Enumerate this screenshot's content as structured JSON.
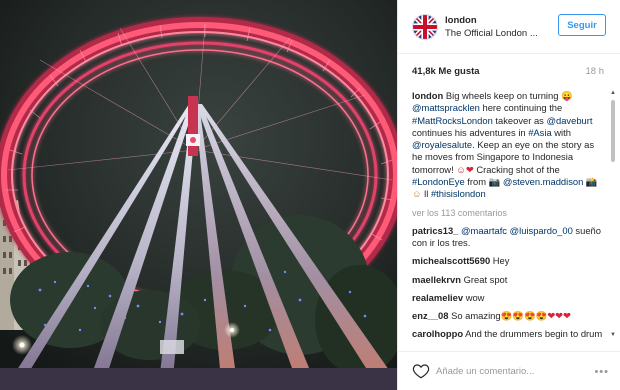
{
  "post": {
    "image_alt": "London Eye at night, lit red, viewed from below",
    "account": {
      "username": "london",
      "full_name": "The Official London ...",
      "avatar_icon": "union-jack-icon"
    },
    "follow_label": "Seguir",
    "likes": "41,8k Me gusta",
    "time_ago": "18 h",
    "caption": {
      "user": "london",
      "t1": " Big wheels keep on turning ",
      "m1": "@mattspracklen",
      "t2": " here continuing the ",
      "h1": "#MattRocksLondon",
      "t3": " takeover as ",
      "m2": "@daveburt",
      "t4": " continues his adventures in ",
      "h2": "#Asia",
      "t5": " with ",
      "m3": "@royalesalute",
      "t6": ". Keep an eye on the story as he moves from Singapore to Indonesia tomorrow! ",
      "e1": "☺❤",
      "t7": " Cracking shot of the ",
      "h3": "#LondonEye",
      "t8": " from ",
      "e2": "📷",
      "m4": "@steven.maddison",
      "e3": " 📸☺",
      "t9": " ll ",
      "h4": "#thisislondon"
    },
    "view_all": "ver los 113 comentarios",
    "comments": [
      {
        "user": "patrics13_",
        "parts": [
          {
            "text": " "
          },
          {
            "text": "@maartafc",
            "tag": true
          },
          {
            "text": " "
          },
          {
            "text": "@luispardo_00",
            "tag": true
          },
          {
            "text": " sueño con ir los tres."
          }
        ]
      },
      {
        "user": "michealscott5690",
        "parts": [
          {
            "text": " Hey"
          }
        ]
      },
      {
        "user": "maellekrvn",
        "parts": [
          {
            "text": " Great spot"
          }
        ]
      },
      {
        "user": "realameliev",
        "parts": [
          {
            "text": " wow"
          }
        ]
      },
      {
        "user": "enz__08",
        "parts": [
          {
            "text": " So amazing"
          },
          {
            "text": "😍😍😍😍",
            "emoji": true
          },
          {
            "text": "❤❤❤",
            "hearts": true
          }
        ]
      },
      {
        "user": "carolhoppo",
        "parts": [
          {
            "text": " And the drummers begin to drum"
          }
        ]
      }
    ],
    "add_comment_placeholder": "Añade un comentario...",
    "icons": {
      "like": "heart-outline-icon",
      "options": "more-options-icon",
      "scroll_up": "scroll-up-arrow-icon",
      "scroll_down": "scroll-down-arrow-icon"
    }
  },
  "colors": {
    "accent": "#3897f0",
    "link": "#003569",
    "muted": "#999999",
    "wheel": "#ff5a78"
  }
}
